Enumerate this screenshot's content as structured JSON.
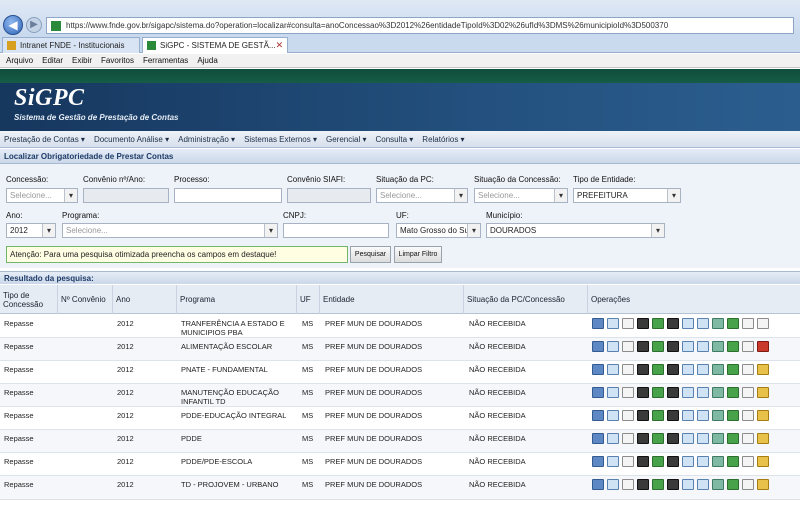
{
  "browser": {
    "url": "https://www.fnde.gov.br/sigapc/sistema.do?operation=localizar#consulta=anoConcessao%3D2012%26entidadeTipoId%3D02%26ufId%3DMS%26municipioId%3D500370",
    "tabs": [
      {
        "label": "Intranet FNDE - Institucionais"
      },
      {
        "label": "SiGPC - SISTEMA DE GESTÃ..."
      }
    ],
    "tab_close": "✕",
    "menu": [
      "Arquivo",
      "Editar",
      "Exibir",
      "Favoritos",
      "Ferramentas",
      "Ajuda"
    ]
  },
  "app": {
    "title": "SiGPC",
    "subtitle": "Sistema de Gestão de Prestação de Contas",
    "menu": [
      "Prestação de Contas ▾",
      "Documento Análise ▾",
      "Administração ▾",
      "Sistemas Externos ▾",
      "Gerencial ▾",
      "Consulta ▾",
      "Relatórios ▾"
    ]
  },
  "search": {
    "title": "Localizar Obrigatoriedade de Prestar Contas",
    "labels": {
      "concessao": "Concessão:",
      "convenio": "Convênio nº/Ano:",
      "processo": "Processo:",
      "siafi": "Convênio SIAFI:",
      "situacao_pc": "Situação da PC:",
      "situacao_concessao": "Situação da Concessão:",
      "tipo_entidade": "Tipo de Entidade:",
      "ano": "Ano:",
      "programa": "Programa:",
      "cnpj": "CNPJ:",
      "uf": "UF:",
      "municipio": "Município:"
    },
    "values": {
      "concessao": "Selecione...",
      "situacao_pc": "Selecione...",
      "situacao_concessao": "Selecione...",
      "tipo_entidade": "PREFEITURA",
      "ano": "2012",
      "programa": "Selecione...",
      "uf": "Mato Grosso do Sul",
      "municipio": "DOURADOS"
    },
    "notice": "Atenção: Para uma pesquisa otimizada preencha os campos em destaque!",
    "buttons": {
      "search": "Pesquisar",
      "clear": "Limpar Filtro"
    }
  },
  "results": {
    "title": "Resultado da pesquisa:",
    "headers": [
      "Tipo de Concessão",
      "Nº Convênio",
      "Ano",
      "Programa",
      "UF",
      "Entidade",
      "Situação da PC/Concessão",
      "Operações"
    ],
    "rows": [
      {
        "tipo": "Repasse",
        "ano": "2012",
        "programa": "TRANFERÊNCIA A ESTADO E MUNICIPIOS PBA",
        "uf": "MS",
        "entidade": "PREF MUN DE DOURADOS",
        "situacao": "NÃO RECEBIDA"
      },
      {
        "tipo": "Repasse",
        "ano": "2012",
        "programa": "ALIMENTAÇÃO ESCOLAR",
        "uf": "MS",
        "entidade": "PREF MUN DE DOURADOS",
        "situacao": "NÃO RECEBIDA"
      },
      {
        "tipo": "Repasse",
        "ano": "2012",
        "programa": "PNATE - FUNDAMENTAL",
        "uf": "MS",
        "entidade": "PREF MUN DE DOURADOS",
        "situacao": "NÃO RECEBIDA"
      },
      {
        "tipo": "Repasse",
        "ano": "2012",
        "programa": "MANUTENÇÃO EDUCAÇÃO INFANTIL TD",
        "uf": "MS",
        "entidade": "PREF MUN DE DOURADOS",
        "situacao": "NÃO RECEBIDA"
      },
      {
        "tipo": "Repasse",
        "ano": "2012",
        "programa": "PDDE-EDUCAÇÃO INTEGRAL",
        "uf": "MS",
        "entidade": "PREF MUN DE DOURADOS",
        "situacao": "NÃO RECEBIDA"
      },
      {
        "tipo": "Repasse",
        "ano": "2012",
        "programa": "PDDE",
        "uf": "MS",
        "entidade": "PREF MUN DE DOURADOS",
        "situacao": "NÃO RECEBIDA"
      },
      {
        "tipo": "Repasse",
        "ano": "2012",
        "programa": "PDDE/PDE-ESCOLA",
        "uf": "MS",
        "entidade": "PREF MUN DE DOURADOS",
        "situacao": "NÃO RECEBIDA"
      },
      {
        "tipo": "Repasse",
        "ano": "2012",
        "programa": "TD - PROJOVEM - URBANO",
        "uf": "MS",
        "entidade": "PREF MUN DE DOURADOS",
        "situacao": "NÃO RECEBIDA"
      }
    ],
    "operation_icons": [
      "grid-icon",
      "export-icon",
      "document-icon",
      "print-icon",
      "refresh-icon",
      "user-icon",
      "image-icon",
      "attach-icon",
      "history-icon",
      "add-icon",
      "report-icon",
      "status-icon"
    ],
    "colors": {
      "header_bg": "#e6ecf3",
      "banner": "#1d3f68",
      "notice_border": "#72b66a"
    }
  }
}
